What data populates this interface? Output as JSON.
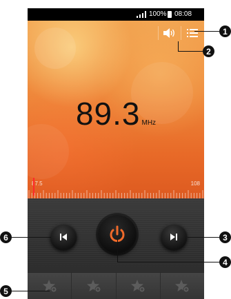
{
  "status_bar": {
    "battery_percent": "100%",
    "time": "08:08"
  },
  "tuner": {
    "frequency": "89.3",
    "unit": "MHz",
    "range_min": "87.5",
    "range_max": "108",
    "tuned_value_mhz": 88.0
  },
  "icons": {
    "speaker": "speaker-icon",
    "list": "list-icon",
    "prev": "skip-previous-icon",
    "next": "skip-next-icon",
    "power": "power-icon",
    "favorite": "star-add-icon"
  },
  "favorites": [
    {
      "slot": "1"
    },
    {
      "slot": "2"
    },
    {
      "slot": "3"
    },
    {
      "slot": "4"
    }
  ],
  "callouts": {
    "c1": "1",
    "c2": "2",
    "c3": "3",
    "c4": "4",
    "c5": "5",
    "c6": "6"
  },
  "colors": {
    "tuner_top": "#f2a350",
    "tuner_bottom": "#dd5a20",
    "needle": "#ff2a2a",
    "accent_power": "#f06a2a",
    "panel_dark": "#2b2b2b"
  }
}
